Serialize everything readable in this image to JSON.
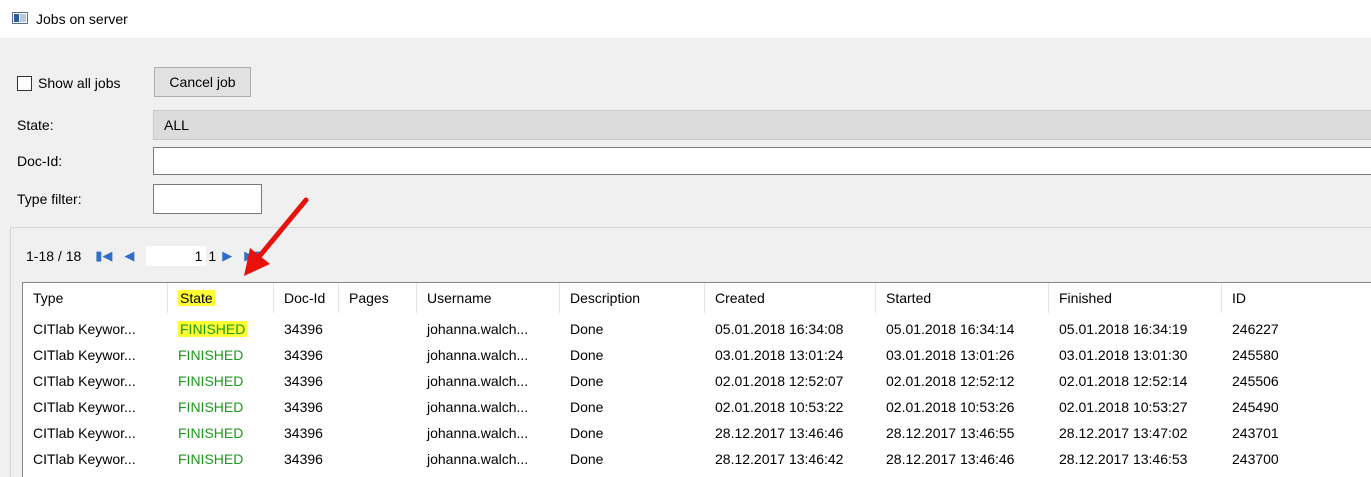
{
  "window": {
    "title": "Jobs on server",
    "icon": "window-icon"
  },
  "controls": {
    "show_all_label": "Show all jobs",
    "cancel_label": "Cancel job",
    "state_label": "State:",
    "state_value": "ALL",
    "docid_label": "Doc-Id:",
    "docid_value": "",
    "type_filter_label": "Type filter:",
    "type_filter_value": ""
  },
  "pager": {
    "count": "1-18 / 18",
    "page": "1",
    "total": "1"
  },
  "table": {
    "columns": [
      "Type",
      "State",
      "Doc-Id",
      "Pages",
      "Username",
      "Description",
      "Created",
      "Started",
      "Finished",
      "ID"
    ],
    "rows": [
      [
        "CITlab Keywor...",
        "FINISHED",
        "34396",
        "",
        "johanna.walch...",
        "Done",
        "05.01.2018 16:34:08",
        "05.01.2018 16:34:14",
        "05.01.2018 16:34:19",
        "246227"
      ],
      [
        "CITlab Keywor...",
        "FINISHED",
        "34396",
        "",
        "johanna.walch...",
        "Done",
        "03.01.2018 13:01:24",
        "03.01.2018 13:01:26",
        "03.01.2018 13:01:30",
        "245580"
      ],
      [
        "CITlab Keywor...",
        "FINISHED",
        "34396",
        "",
        "johanna.walch...",
        "Done",
        "02.01.2018 12:52:07",
        "02.01.2018 12:52:12",
        "02.01.2018 12:52:14",
        "245506"
      ],
      [
        "CITlab Keywor...",
        "FINISHED",
        "34396",
        "",
        "johanna.walch...",
        "Done",
        "02.01.2018 10:53:22",
        "02.01.2018 10:53:26",
        "02.01.2018 10:53:27",
        "245490"
      ],
      [
        "CITlab Keywor...",
        "FINISHED",
        "34396",
        "",
        "johanna.walch...",
        "Done",
        "28.12.2017 13:46:46",
        "28.12.2017 13:46:55",
        "28.12.2017 13:47:02",
        "243701"
      ],
      [
        "CITlab Keywor...",
        "FINISHED",
        "34396",
        "",
        "johanna.walch...",
        "Done",
        "28.12.2017 13:46:42",
        "28.12.2017 13:46:46",
        "28.12.2017 13:46:53",
        "243700"
      ]
    ]
  },
  "colors": {
    "finished": "#1b9a1b",
    "highlight": "#ffff33",
    "arrow": "#e8120c",
    "pager_icons": "#2f6fc9"
  }
}
